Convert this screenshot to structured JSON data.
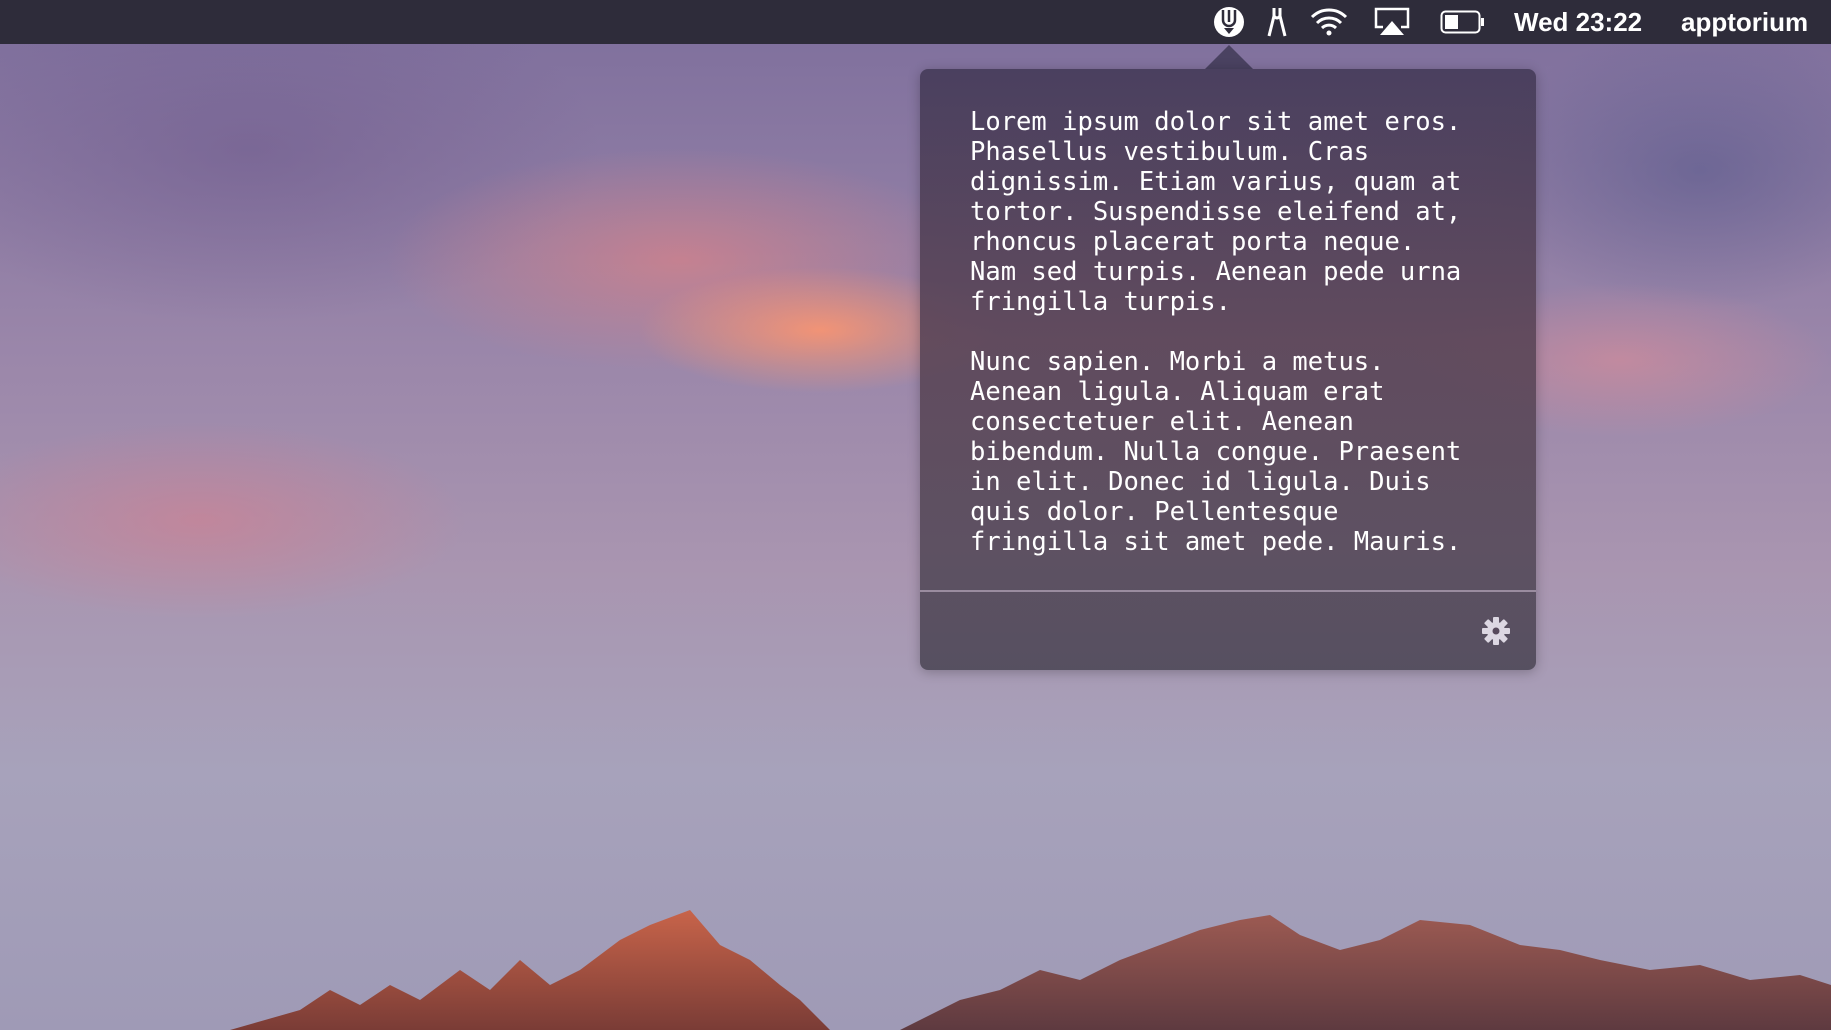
{
  "menubar": {
    "icons": [
      "app-fork-icon",
      "scissors-icon",
      "wifi-icon",
      "airplay-icon",
      "battery-icon"
    ],
    "clock": "Wed 23:22",
    "user": "apptorium"
  },
  "popover": {
    "text": "Lorem ipsum dolor sit amet eros.\nPhasellus vestibulum. Cras\ndignissim. Etiam varius, quam at\ntortor. Suspendisse eleifend at,\nrhoncus placerat porta neque.\nNam sed turpis. Aenean pede urna\nfringilla turpis.\n\nNunc sapien. Morbi a metus.\nAenean ligula. Aliquam erat\nconsectetuer elit. Aenean\nbibendum. Nulla congue. Praesent\nin elit. Donec id ligula. Duis\nquis dolor. Pellentesque\nfringilla sit amet pede. Mauris.",
    "settings_icon": "gear-icon"
  }
}
